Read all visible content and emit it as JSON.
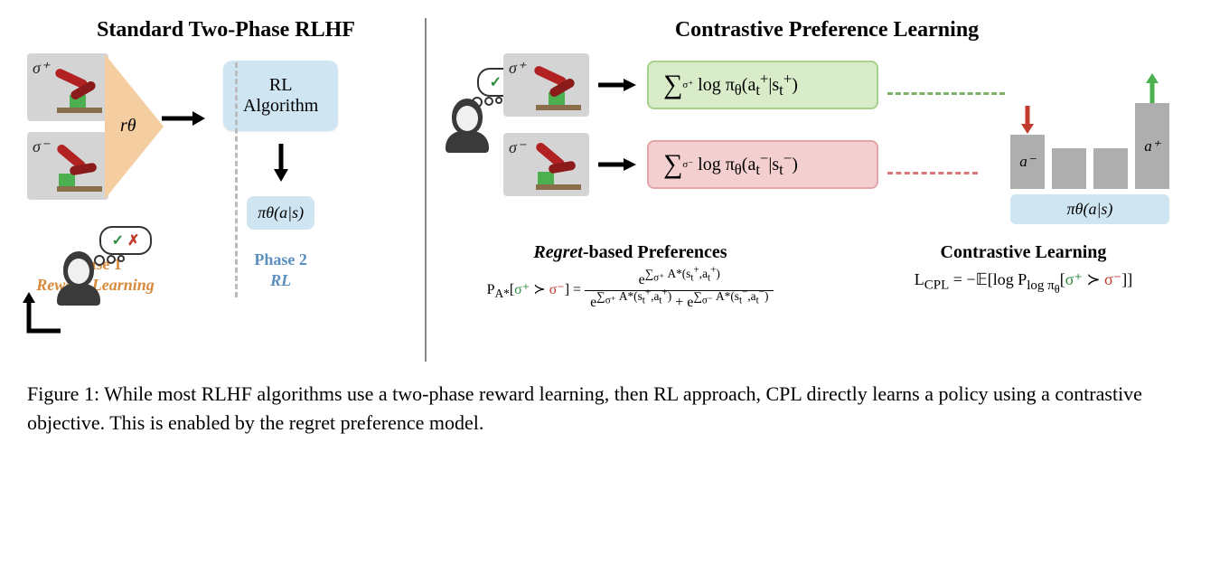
{
  "left": {
    "title": "Standard Two-Phase RLHF",
    "sigma_plus": "σ⁺",
    "sigma_minus": "σ⁻",
    "reward_label": "rθ",
    "rl_box_line1": "RL",
    "rl_box_line2": "Algorithm",
    "policy": "πθ(a|s)",
    "phase1_title": "Phase 1",
    "phase1_sub": "Reward Learning",
    "phase2_title": "Phase 2",
    "phase2_sub": "RL"
  },
  "right": {
    "title": "Contrastive Preference Learning",
    "sigma_plus": "σ⁺",
    "sigma_minus": "σ⁻",
    "sum_plus": "∑σ⁺ log πθ(aₜ⁺|sₜ⁺)",
    "sum_minus": "∑σ⁻ log πθ(aₜ⁻|sₜ⁻)",
    "bar_minus": "a⁻",
    "bar_plus": "a⁺",
    "policy_strip": "πθ(a|s)",
    "regret_title_em": "Regret",
    "regret_title_rest": "-based Preferences",
    "regret_lhs": "P_A*[σ⁺ ≻ σ⁻] =",
    "regret_num": "e^{∑σ⁺ A*(sₜ⁺,aₜ⁺)}",
    "regret_den": "e^{∑σ⁺ A*(sₜ⁺,aₜ⁺)} + e^{∑σ⁻ A*(sₜ⁻,aₜ⁻)}",
    "contrastive_title": "Contrastive Learning",
    "contrastive_formula": "L_CPL = −𝔼[log P_{log πθ}[σ⁺ ≻ σ⁻]]"
  },
  "chart_data": {
    "type": "bar",
    "categories": [
      "a⁻",
      "",
      "",
      "a⁺"
    ],
    "values": [
      60,
      45,
      45,
      95
    ],
    "annotations": [
      {
        "index": 0,
        "direction": "down",
        "color": "#c0392b"
      },
      {
        "index": 3,
        "direction": "up",
        "color": "#4caf50"
      }
    ],
    "axis_label": "πθ(a|s)",
    "title": "Contrastive Learning"
  },
  "caption": "Figure 1: While most RLHF algorithms use a two-phase reward learning, then RL approach, CPL directly learns a policy using a contrastive objective. This is enabled by the regret preference model."
}
